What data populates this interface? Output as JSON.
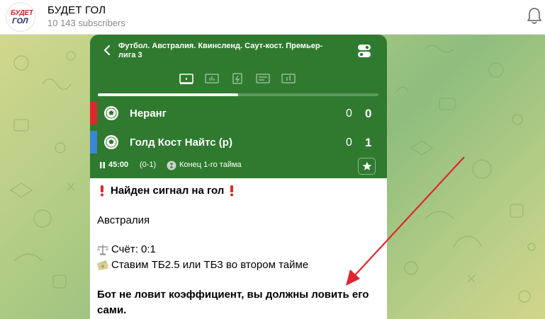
{
  "channel": {
    "title": "БУДЕТ ГОЛ",
    "subscribers": "10 143 subscribers",
    "logo_top": "БУДЕТ",
    "logo_bottom": "ГОЛ"
  },
  "match_card": {
    "league": "Футбол. Австралия. Квинсленд. Саут-кост. Премьер-лига 3",
    "progress_fraction": 0.5,
    "teams": [
      {
        "name": "Неранг",
        "score_half": "0",
        "score_total": "0",
        "stripe_color": "#e0262d"
      },
      {
        "name": "Голд Кост Найтс (р)",
        "score_half": "0",
        "score_total": "1",
        "stripe_color": "#3a86d8"
      }
    ],
    "time": "45:00",
    "half_score": "(0-1)",
    "period": "Конец 1-го тайма",
    "bg_color": "#2f7a2f"
  },
  "message": {
    "signal": "Найден сигнал на гол",
    "country": "Австралия",
    "score_line": "Счёт: 0:1",
    "bet_line": "Ставим ТБ2.5 или ТБ3 во втором тайме",
    "warning_line1": "Бот не ловит коэффициент, вы должны ловить его",
    "warning_line2": "сами."
  },
  "icons": {
    "back": "chevron-left-icon",
    "toggle": "toggle-icon",
    "bell": "bell-icon",
    "ball": "soccer-ball-icon",
    "pause": "pause-icon",
    "hourglass": "hourglass-icon",
    "star": "star-icon",
    "scale": "balance-scale-icon",
    "money": "money-icon",
    "exclamation": "exclamation-icon"
  },
  "annotation_color": "#e0262d"
}
